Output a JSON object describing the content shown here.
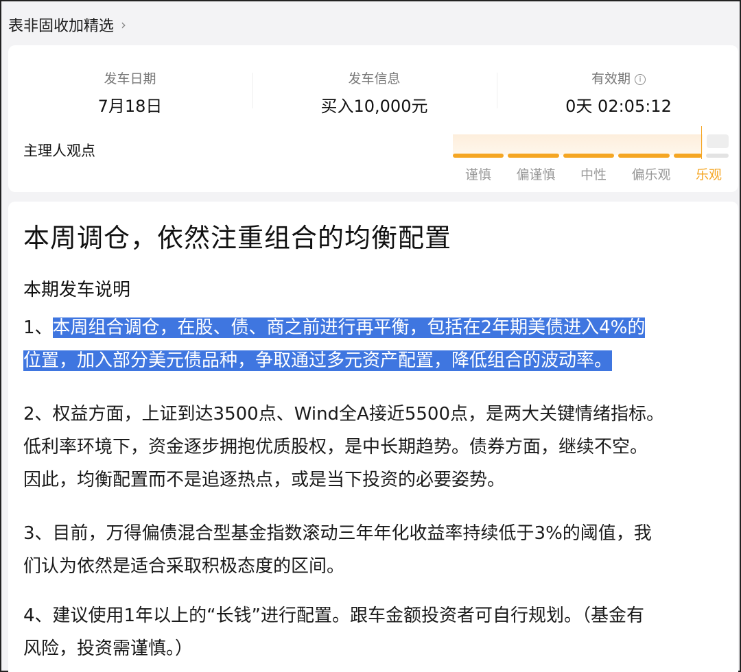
{
  "header": {
    "title": "表非固收加精选",
    "chevron": "›"
  },
  "stats": [
    {
      "label": "发车日期",
      "value": "7月18日"
    },
    {
      "label": "发车信息",
      "value": "买入10,000元"
    },
    {
      "label": "有效期",
      "value": "0天 02:05:12",
      "info_icon": "ⓘ"
    }
  ],
  "opinion": {
    "label": "主理人观点",
    "levels": [
      "谨慎",
      "偏谨慎",
      "中性",
      "偏乐观",
      "乐观"
    ],
    "selected": "乐观",
    "accent": "#f5a623"
  },
  "article": {
    "title": "本周调仓，依然注重组合的均衡配置",
    "subhead": "本期发车说明",
    "p1_prefix": "1、",
    "p1_line1": "本周组合调仓，在股、债、商之前进行再平衡，包括在2年期美债进入4%的",
    "p1_line2": "位置，加入部分美元债品种，争取通过多元资产配置，降低组合的波动率。",
    "p2_line1": "2、权益方面，上证到达3500点、Wind全A接近5500点，是两大关键情绪指标。",
    "p2_line2": "低利率环境下，资金逐步拥抱优质股权，是中长期趋势。债券方面，继续不空。",
    "p2_line3": "因此，均衡配置而不是追逐热点，或是当下投资的必要姿势。",
    "p3_line1": "3、目前，万得偏债混合型基金指数滚动三年年化收益率持续低于3%的阈值，我",
    "p3_line2": "们认为依然是适合采取积极态度的区间。",
    "p4_line1": "4、建议使用1年以上的“长钱”进行配置。跟车金额投资者可自行规划。（基金有",
    "p4_line2": "风险，投资需谨慎。）",
    "highlight_color": "#3f76e0"
  }
}
